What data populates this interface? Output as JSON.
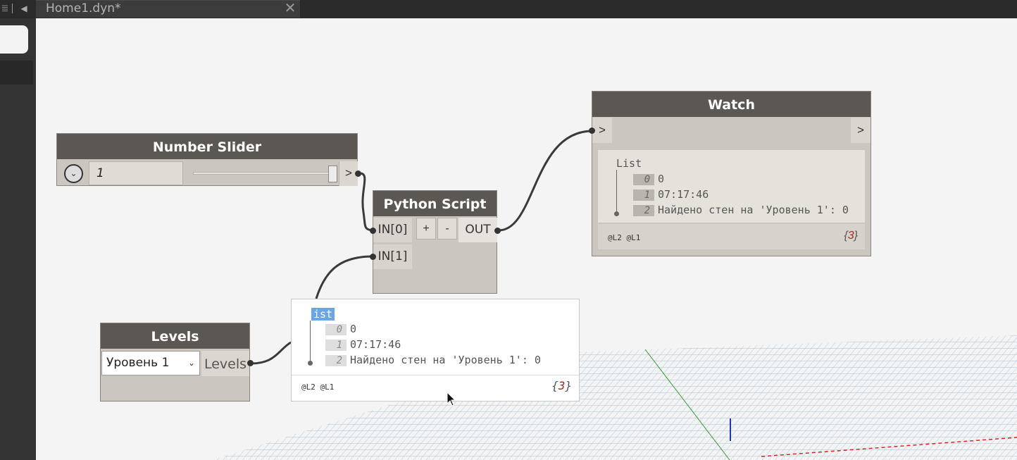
{
  "window": {
    "tab_title": "Home1.dyn*",
    "tab_close": "✕"
  },
  "nodes": {
    "number_slider": {
      "title": "Number Slider",
      "value": "1",
      "value_fraction": 1.0,
      "output_port": ">"
    },
    "python_script": {
      "title": "Python Script",
      "inputs": [
        "IN[0]",
        "IN[1]"
      ],
      "add_input": "+",
      "remove_input": "-",
      "output": "OUT"
    },
    "watch": {
      "title": "Watch",
      "input_port": ">",
      "output_port": ">",
      "list_title": "List",
      "items": [
        {
          "index": "0",
          "value": "0"
        },
        {
          "index": "1",
          "value": "07:17:46"
        },
        {
          "index": "2",
          "value": "Найдено стен на 'Уровень 1': 0"
        }
      ],
      "levels": "@L2 @L1",
      "count_open": "{",
      "count": "3",
      "count_close": "}"
    },
    "levels": {
      "title": "Levels",
      "selected": "Уровень 1",
      "output": "Levels"
    }
  },
  "preview_popup": {
    "list_title": "List",
    "list_title_selected": "ist",
    "items": [
      {
        "index": "0",
        "value": "0"
      },
      {
        "index": "1",
        "value": "07:17:46"
      },
      {
        "index": "2",
        "value": "Найдено стен на 'Уровень 1': 0"
      }
    ],
    "levels": "@L2 @L1",
    "count_open": "{",
    "count": "3",
    "count_close": "}"
  },
  "icons": {
    "menu": "≣",
    "collapse": "◀",
    "slider_expand": "⌄",
    "dropdown": "⌄"
  },
  "colors": {
    "node_header": "#5b5752",
    "node_body": "#cbc7c0",
    "canvas": "#f4f4f4",
    "selection": "#6aa6e6"
  }
}
